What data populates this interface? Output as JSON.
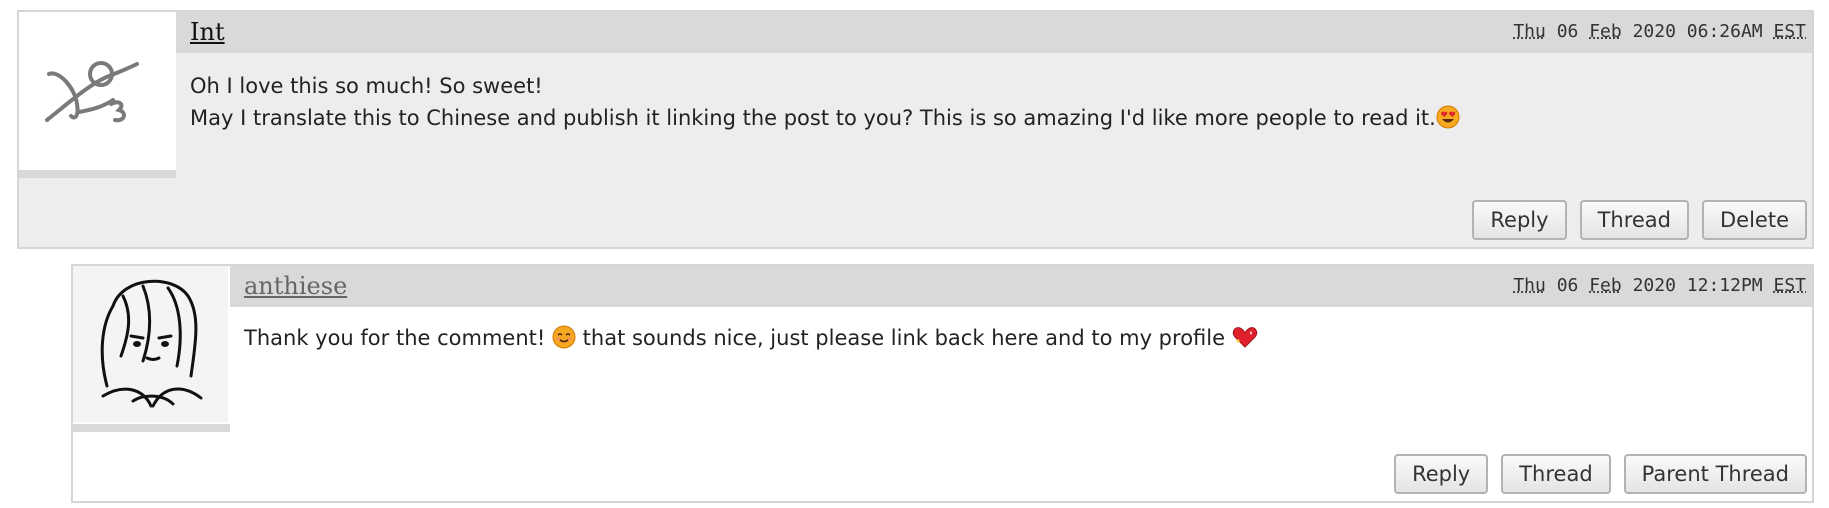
{
  "comments": [
    {
      "username": "Int",
      "date_parts": {
        "day": "Thu",
        "date": "06",
        "month": "Feb",
        "year": "2020",
        "time": "06:26AM",
        "tz": "EST"
      },
      "lines": [
        "Oh I love this so much! So sweet!",
        "May I translate this to Chinese and publish it linking the post to you? This is so amazing I'd like more people to read it."
      ],
      "emoji": "smiling-face-heart-eyes",
      "buttons": {
        "reply": "Reply",
        "thread": "Thread",
        "delete": "Delete"
      }
    },
    {
      "username": "anthiese",
      "date_parts": {
        "day": "Thu",
        "date": "06",
        "month": "Feb",
        "year": "2020",
        "time": "12:12PM",
        "tz": "EST"
      },
      "text_before": "Thank you for the comment!",
      "text_after": "that sounds nice, just please link back here and to my profile",
      "emojis": [
        "smiling-face",
        "sparkling-heart"
      ],
      "buttons": {
        "reply": "Reply",
        "thread": "Thread",
        "parent_thread": "Parent Thread"
      }
    }
  ],
  "colors": {
    "header_bg": "#d9d9d9",
    "comment1_bg": "#ededed",
    "comment2_bg": "#ffffff"
  }
}
